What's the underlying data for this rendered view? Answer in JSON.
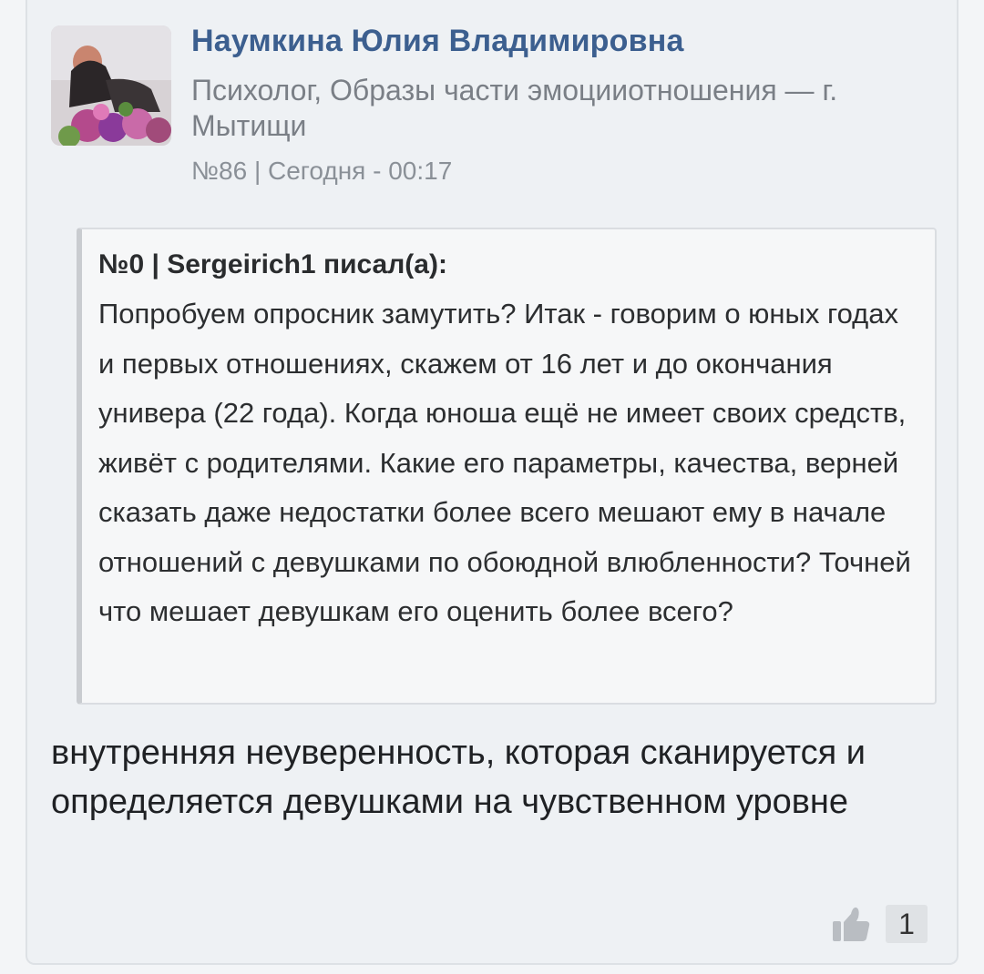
{
  "post": {
    "author_name": "Наумкина Юлия Владимировна",
    "author_description": "Психолог, Образы части эмоцииотношения — г. Мытищи",
    "meta": "№86 | Сегодня - 00:17",
    "quote": {
      "header": "№0 | Sergeirich1 писал(а):",
      "text": "Попробуем опросник замутить? Итак - говорим о юных годах и первых отношениях, скажем от 16 лет и до окончания универа (22 года). Когда юноша ещё не имеет своих средств, живёт с родителями. Какие его параметры, качества, верней сказать даже недостатки более всего мешают ему в начале отношений с девушками по обоюдной влюбленности? Точней что мешает девушкам его оценить более всего?"
    },
    "reply": "внутренняя неуверенность, которая сканируется и определяется девушками на чувственном уровне",
    "likes": {
      "icon": "thumbs-up-icon",
      "count": "1"
    }
  },
  "colors": {
    "author_name": "#3c5f8f",
    "meta_text": "#8a9097",
    "card_background": "#eef1f4",
    "quote_background": "#f6f7f8"
  }
}
